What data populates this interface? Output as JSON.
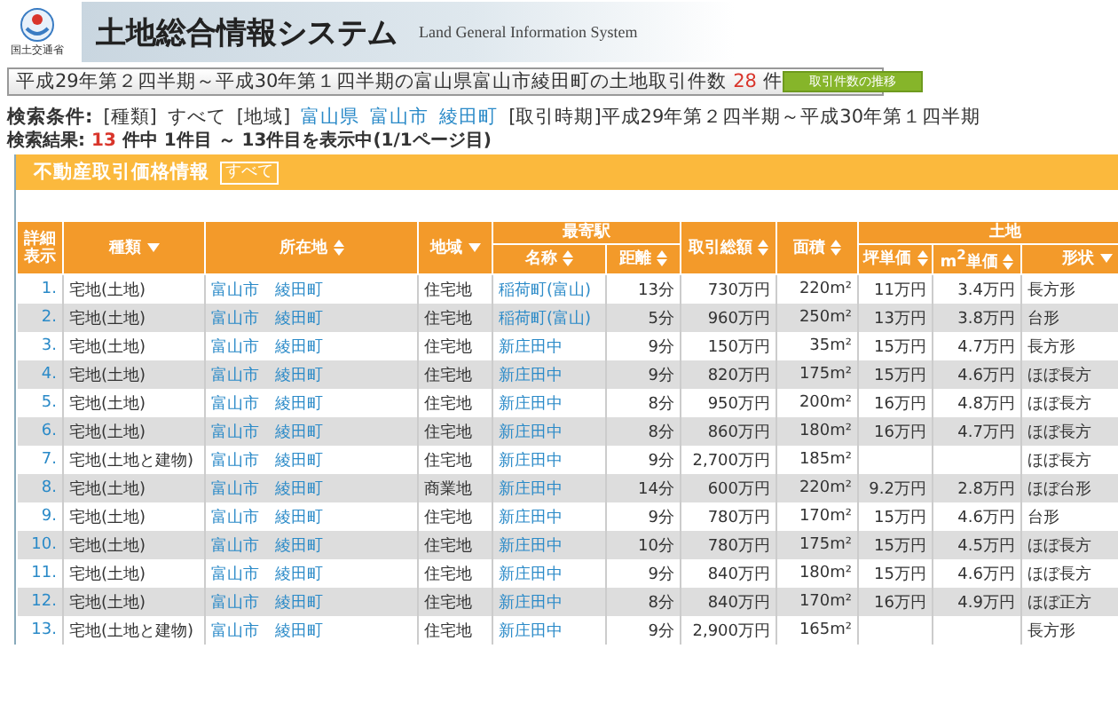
{
  "header": {
    "logo_caption": "国土交通省",
    "title": "土地総合情報システム",
    "subtitle": "Land General Information System"
  },
  "count_bar": {
    "text_before": "平成29年第２四半期～平成30年第１四半期の富山県富山市綾田町の土地取引件数",
    "count": "28",
    "unit": "件",
    "button": "取引件数の推移"
  },
  "search_conditions": {
    "label": "検索条件:",
    "type_label": "[種類]",
    "type_value": "すべて",
    "area_label": "[地域]",
    "areas": [
      "富山県",
      "富山市",
      "綾田町"
    ],
    "period": "[取引時期]平成29年第２四半期～平成30年第１四半期"
  },
  "search_result": {
    "label": "検索結果:",
    "count": "13",
    "rest": "件中 1件目 ～ 13件目を表示中(1/1ページ目)"
  },
  "panel": {
    "title": "不動産取引価格情報",
    "tag": "すべて"
  },
  "table": {
    "column_groups": [
      {
        "label": "最寄駅"
      },
      {
        "label": "土地"
      }
    ],
    "columns": [
      {
        "label": "詳細表示",
        "kind": "plain"
      },
      {
        "label": "種類",
        "kind": "filterable"
      },
      {
        "label": "所在地",
        "kind": "sortable"
      },
      {
        "label": "地域",
        "kind": "filterable"
      },
      {
        "label": "名称",
        "kind": "sortable"
      },
      {
        "label": "距離",
        "kind": "sortable"
      },
      {
        "label": "取引総額",
        "kind": "sortable"
      },
      {
        "label": "面積",
        "kind": "sortable"
      },
      {
        "label": "坪単価",
        "kind": "sortable"
      },
      {
        "label": "m$^{2}$単価",
        "kind": "sortable"
      },
      {
        "label": "形状",
        "kind": "filterable"
      }
    ],
    "rows": [
      [
        "1.",
        "宅地(土地)",
        "富山市　綾田町",
        "住宅地",
        "稲荷町(富山)",
        "13分",
        "730万円",
        "220m²",
        "11万円",
        "3.4万円",
        "長方形"
      ],
      [
        "2.",
        "宅地(土地)",
        "富山市　綾田町",
        "住宅地",
        "稲荷町(富山)",
        "5分",
        "960万円",
        "250m²",
        "13万円",
        "3.8万円",
        "台形"
      ],
      [
        "3.",
        "宅地(土地)",
        "富山市　綾田町",
        "住宅地",
        "新庄田中",
        "9分",
        "150万円",
        "35m²",
        "15万円",
        "4.7万円",
        "長方形"
      ],
      [
        "4.",
        "宅地(土地)",
        "富山市　綾田町",
        "住宅地",
        "新庄田中",
        "9分",
        "820万円",
        "175m²",
        "15万円",
        "4.6万円",
        "ほぼ長方"
      ],
      [
        "5.",
        "宅地(土地)",
        "富山市　綾田町",
        "住宅地",
        "新庄田中",
        "8分",
        "950万円",
        "200m²",
        "16万円",
        "4.8万円",
        "ほぼ長方"
      ],
      [
        "6.",
        "宅地(土地)",
        "富山市　綾田町",
        "住宅地",
        "新庄田中",
        "8分",
        "860万円",
        "180m²",
        "16万円",
        "4.7万円",
        "ほぼ長方"
      ],
      [
        "7.",
        "宅地(土地と建物)",
        "富山市　綾田町",
        "住宅地",
        "新庄田中",
        "9分",
        "2,700万円",
        "185m²",
        "",
        "",
        "ほぼ長方"
      ],
      [
        "8.",
        "宅地(土地)",
        "富山市　綾田町",
        "商業地",
        "新庄田中",
        "14分",
        "600万円",
        "220m²",
        "9.2万円",
        "2.8万円",
        "ほぼ台形"
      ],
      [
        "9.",
        "宅地(土地)",
        "富山市　綾田町",
        "住宅地",
        "新庄田中",
        "9分",
        "780万円",
        "170m²",
        "15万円",
        "4.6万円",
        "台形"
      ],
      [
        "10.",
        "宅地(土地)",
        "富山市　綾田町",
        "住宅地",
        "新庄田中",
        "10分",
        "780万円",
        "175m²",
        "15万円",
        "4.5万円",
        "ほぼ長方"
      ],
      [
        "11.",
        "宅地(土地)",
        "富山市　綾田町",
        "住宅地",
        "新庄田中",
        "9分",
        "840万円",
        "180m²",
        "15万円",
        "4.6万円",
        "ほぼ長方"
      ],
      [
        "12.",
        "宅地(土地)",
        "富山市　綾田町",
        "住宅地",
        "新庄田中",
        "8分",
        "840万円",
        "170m²",
        "16万円",
        "4.9万円",
        "ほぼ正方"
      ],
      [
        "13.",
        "宅地(土地と建物)",
        "富山市　綾田町",
        "住宅地",
        "新庄田中",
        "9分",
        "2,900万円",
        "165m²",
        "",
        "",
        "長方形"
      ]
    ]
  }
}
